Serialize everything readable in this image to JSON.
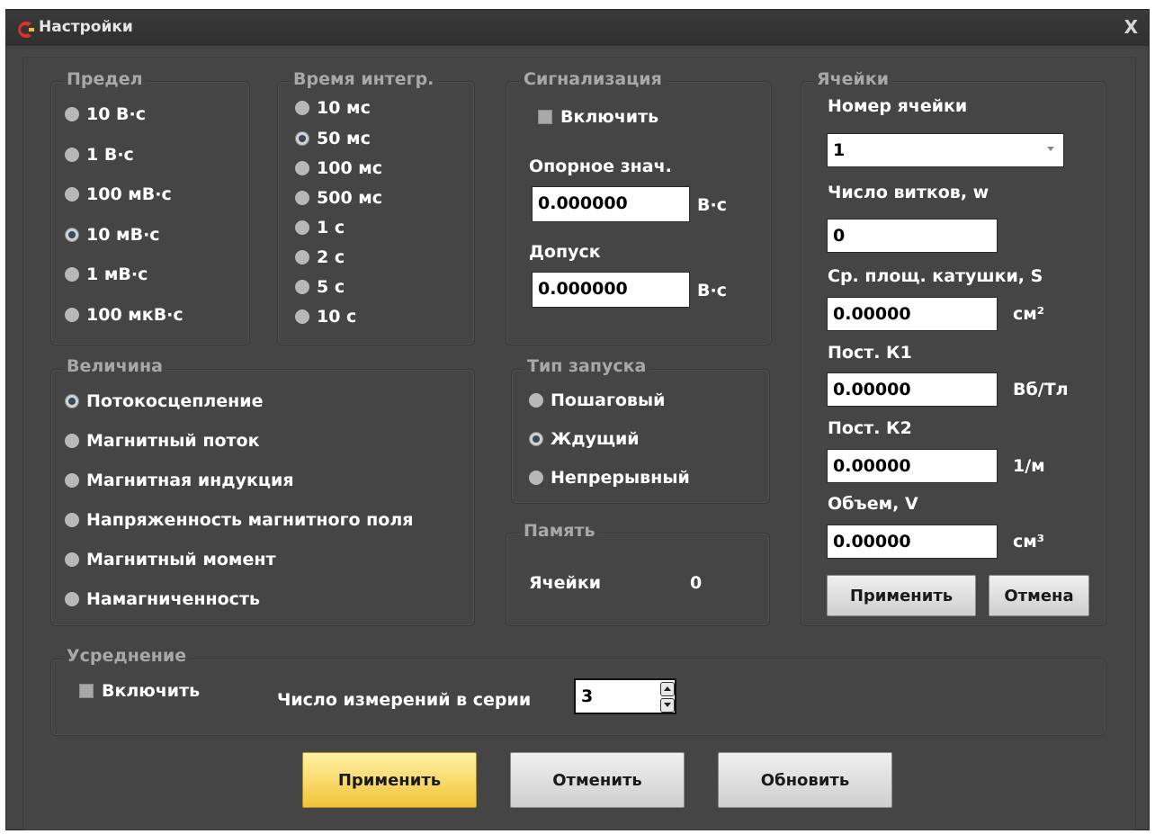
{
  "window": {
    "title": "Настройки",
    "close_label": "X",
    "accent": "#e0302a"
  },
  "limit": {
    "legend": "Предел",
    "options": [
      "10 В·с",
      "1 В·с",
      "100 мВ·с",
      "10 мВ·с",
      "1 мВ·с",
      "100 мкВ·с"
    ],
    "selected": "10 мВ·с"
  },
  "integ": {
    "legend": "Время интегр.",
    "options": [
      "10 мс",
      "50 мс",
      "100 мс",
      "500 мс",
      "1 с",
      "2 с",
      "5 с",
      "10 с"
    ],
    "selected": "50 мс"
  },
  "alarm": {
    "legend": "Сигнализация",
    "enable_label": "Включить",
    "enabled": false,
    "ref_label": "Опорное знач.",
    "ref_value": "0.000000",
    "ref_unit": "В·с",
    "tol_label": "Допуск",
    "tol_value": "0.000000",
    "tol_unit": "В·с"
  },
  "quantity": {
    "legend": "Величина",
    "options": [
      "Потокосцепление",
      "Магнитный поток",
      "Магнитная индукция",
      "Напряженность магнитного поля",
      "Магнитный момент",
      "Намагниченность"
    ],
    "selected": "Потокосцепление"
  },
  "trigger": {
    "legend": "Тип запуска",
    "options": [
      "Пошаговый",
      "Ждущий",
      "Непрерывный"
    ],
    "selected": "Ждущий"
  },
  "memory": {
    "legend": "Память",
    "cells_label": "Ячейки",
    "cells_value": "0"
  },
  "cells": {
    "legend": "Ячейки",
    "number_label": "Номер ячейки",
    "number_value": "1",
    "turns_label": "Число витков, w",
    "turns_value": "0",
    "area_label": "Ср. площ. катушки, S",
    "area_value": "0.00000",
    "area_unit": "см²",
    "k1_label": "Пост. К1",
    "k1_value": "0.00000",
    "k1_unit": "Вб/Тл",
    "k2_label": "Пост. К2",
    "k2_value": "0.00000",
    "k2_unit": "1/м",
    "vol_label": "Объем, V",
    "vol_value": "0.00000",
    "vol_unit": "см³",
    "apply_label": "Применить",
    "cancel_label": "Отмена"
  },
  "averaging": {
    "legend": "Усреднение",
    "enable_label": "Включить",
    "enabled": false,
    "count_label": "Число измерений в серии",
    "count_value": "3"
  },
  "footer": {
    "apply_label": "Применить",
    "cancel_label": "Отменить",
    "refresh_label": "Обновить"
  }
}
